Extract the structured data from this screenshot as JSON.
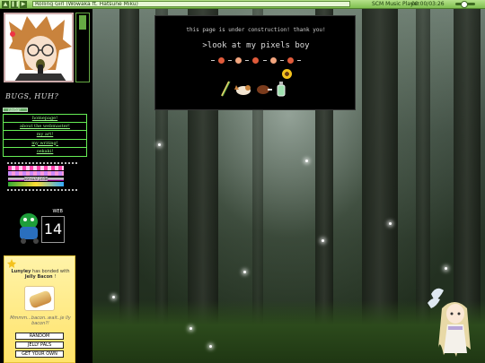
{
  "player": {
    "title": "Rolling Girl (Wowaka ft. Hatsune Miku)",
    "brand": "SCM Music Player",
    "time": "00:00/03:26",
    "buttons": [
      "prev",
      "pause",
      "next"
    ]
  },
  "sidebar": {
    "tagline": "BUGS, HUH?",
    "link_badge": "navbar",
    "nav": [
      "homepage!",
      "about the webmaster!",
      "my art!",
      "my writing!",
      "oekaki!"
    ],
    "web14_label": "WEB",
    "web14_number": "14",
    "pride_label": "asexual pride",
    "adopt": {
      "name": "Lunyley",
      "text_mid": "has bonded with",
      "pet": "Jelly Bacon",
      "text_end": "!",
      "quote": "Mmmm...bacon..wait..je lly bacon?!",
      "buttons": [
        "RANDOM",
        "JELLY PALS",
        "GET YOUR OWN"
      ]
    }
  },
  "panel": {
    "construction_text": "this page is under construction! thank you!",
    "look_text": ">look at my pixels boy"
  },
  "colors": {
    "player_bg": "#9fd46c",
    "nav_border": "#66ee55",
    "nav_text": "#99ff88",
    "adopt_bg": "#ffe36a"
  }
}
